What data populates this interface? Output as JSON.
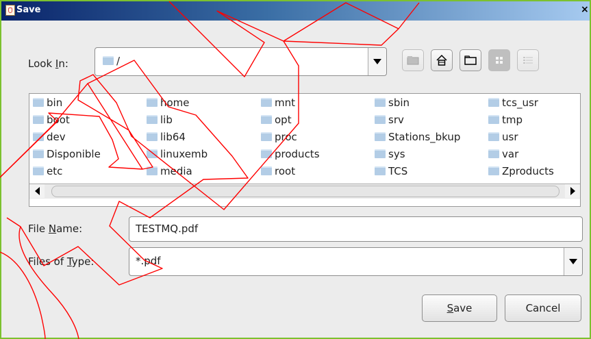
{
  "window": {
    "title": "Save",
    "close_glyph": "×"
  },
  "look_in": {
    "label_pre": "Look ",
    "label_mn": "I",
    "label_post": "n:",
    "value": "/"
  },
  "toolbar": {
    "buttons": [
      {
        "icon": "up-folder-icon"
      },
      {
        "icon": "home-icon"
      },
      {
        "icon": "new-folder-icon"
      },
      {
        "icon": "list-view-icon"
      },
      {
        "icon": "details-view-icon"
      }
    ]
  },
  "files": {
    "columns": [
      [
        "bin",
        "boot",
        "dev",
        "Disponible",
        "etc"
      ],
      [
        "home",
        "lib",
        "lib64",
        "linuxemb",
        "media"
      ],
      [
        "mnt",
        "opt",
        "proc",
        "products",
        "root"
      ],
      [
        "sbin",
        "srv",
        "Stations_bkup",
        "sys",
        "TCS"
      ],
      [
        "tcs_usr",
        "tmp",
        "usr",
        "var",
        "Zproducts"
      ]
    ]
  },
  "file_name": {
    "label_pre": "File ",
    "label_mn": "N",
    "label_post": "ame:",
    "value": "TESTMQ.pdf"
  },
  "file_type": {
    "label_pre": "Files of ",
    "label_mn": "T",
    "label_post": "ype:",
    "value": "*.pdf"
  },
  "buttons": {
    "save": {
      "mn": "S",
      "rest": "ave"
    },
    "cancel": "Cancel"
  },
  "colors": {
    "frame_border": "#7cc12f",
    "annotation": "#ff0000",
    "folder": "#b3cde6"
  }
}
